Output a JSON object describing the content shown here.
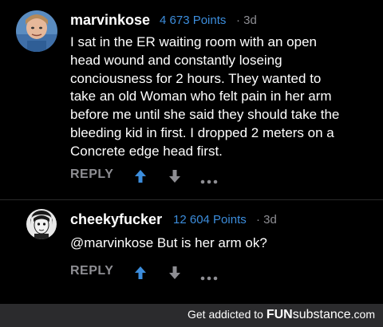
{
  "comments": [
    {
      "username": "marvinkose",
      "points": "4 673 Points",
      "time": "· 3d",
      "lines": [
        "I sat in the ER waiting room with an open",
        "head wound and constantly loseing",
        "conciousness for 2 hours. They wanted to",
        "take an old Woman who felt pain in her arm",
        "before me until she said they should take the",
        "bleeding kid in first. I dropped 2 meters on a",
        "Concrete edge head first."
      ],
      "reply_label": "REPLY",
      "upvote_active": true
    },
    {
      "username": "cheekyfucker",
      "points": "12 604 Points",
      "time": "· 3d",
      "lines": [
        "@marvinkose But is her arm ok?"
      ],
      "reply_label": "REPLY",
      "upvote_active": true
    }
  ],
  "footer": {
    "text": "Get addicted to",
    "brand_bold": "FUN",
    "brand_rest": "substance",
    "brand_suffix": ".com"
  },
  "colors": {
    "accent": "#3c8ddc",
    "muted": "#8e8e93",
    "background": "#000000",
    "footer_bg": "#2b2b2d"
  },
  "icons": {
    "upvote": "arrow-up-icon",
    "downvote": "arrow-down-icon",
    "more": "more-dots-icon"
  }
}
